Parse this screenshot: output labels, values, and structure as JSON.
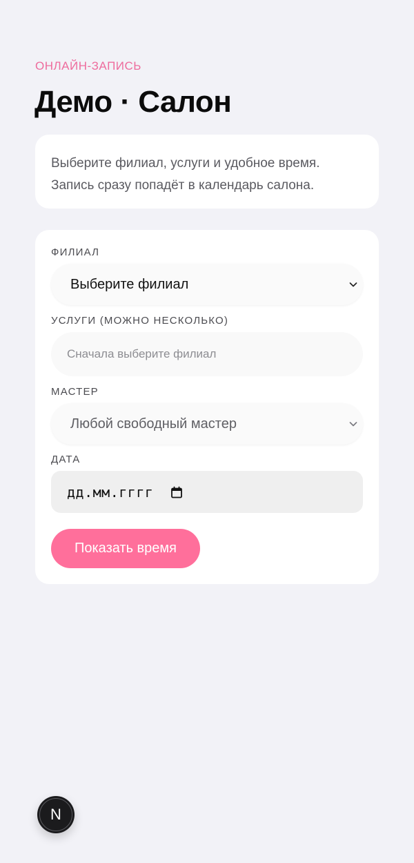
{
  "header": {
    "eyebrow": "ОНЛАЙН-ЗАПИСЬ",
    "title": "Демо · Салон"
  },
  "intro": {
    "line1": "Выберите филиал, услуги и удобное время.",
    "line2": "Запись сразу попадёт в календарь салона."
  },
  "form": {
    "branch": {
      "label": "ФИЛИАЛ",
      "value": "Выберите филиал"
    },
    "services": {
      "label": "УСЛУГИ (МОЖНО НЕСКОЛЬКО)",
      "placeholder": "Сначала выберите филиал"
    },
    "master": {
      "label": "МАСТЕР",
      "value": "Любой свободный мастер"
    },
    "date": {
      "label": "ДАТА",
      "placeholder": "дд.мм.гггг"
    },
    "submit_label": "Показать время"
  },
  "dev_badge": {
    "letter": "N"
  },
  "colors": {
    "accent": "#ff6f9b",
    "eyebrow": "#ee6c9d",
    "background": "#f2f2f7"
  },
  "icons": {
    "select_arrow": "chevron-down-icon",
    "date_picker": "calendar-icon"
  }
}
